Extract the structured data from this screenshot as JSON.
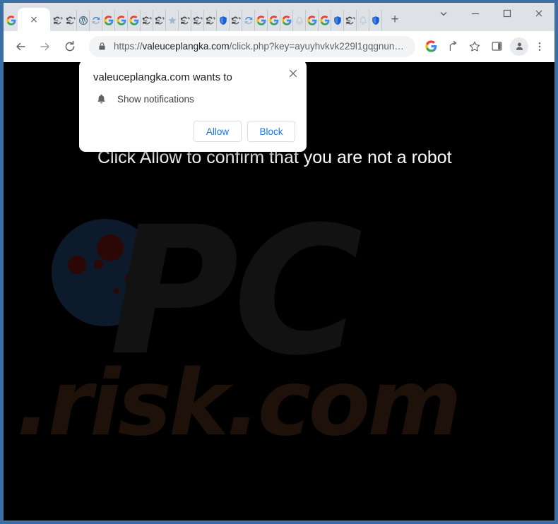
{
  "window": {
    "controls": [
      {
        "name": "tab-search-button",
        "glyph": "chevron-down"
      },
      {
        "name": "minimize-button",
        "glyph": "minimize"
      },
      {
        "name": "maximize-button",
        "glyph": "maximize"
      },
      {
        "name": "close-button",
        "glyph": "close"
      }
    ]
  },
  "tabstrip": {
    "active_tab": {
      "close_label": "×",
      "favicon": "google"
    },
    "leading_favicon": "google",
    "new_tab_label": "+",
    "tabs": [
      {
        "favicon": "ie"
      },
      {
        "favicon": "ie"
      },
      {
        "favicon": "wordpress"
      },
      {
        "favicon": "refresh"
      },
      {
        "favicon": "google"
      },
      {
        "favicon": "google"
      },
      {
        "favicon": "google"
      },
      {
        "favicon": "ie"
      },
      {
        "favicon": "ie"
      },
      {
        "favicon": "star"
      },
      {
        "favicon": "ie"
      },
      {
        "favicon": "ie"
      },
      {
        "favicon": "ie"
      },
      {
        "favicon": "shield"
      },
      {
        "favicon": "ie"
      },
      {
        "favicon": "refresh"
      },
      {
        "favicon": "google"
      },
      {
        "favicon": "google"
      },
      {
        "favicon": "google"
      },
      {
        "favicon": "bell"
      },
      {
        "favicon": "google"
      },
      {
        "favicon": "google"
      },
      {
        "favicon": "shield"
      },
      {
        "favicon": "ie"
      },
      {
        "favicon": "bell"
      },
      {
        "favicon": "shield"
      }
    ]
  },
  "toolbar": {
    "back_label": "Back",
    "forward_label": "Forward",
    "reload_label": "Reload",
    "omnibox": {
      "lock_icon": "lock-icon",
      "scheme": "https://",
      "host": "valeuceplangka.com",
      "path": "/click.php?key=ayuyhvkvk229l1gqgnun…",
      "full_url": "https://valeuceplangka.com/click.php?key=ayuyhvkvk229l1gqgnun…"
    },
    "actions": [
      {
        "name": "google-lens-icon",
        "label": "Search with Google"
      },
      {
        "name": "share-icon",
        "label": "Share this page"
      },
      {
        "name": "bookmark-star-icon",
        "label": "Bookmark this tab"
      },
      {
        "name": "side-panel-icon",
        "label": "Show side panel"
      }
    ],
    "avatar_label": "Profile",
    "menu_label": "Customize and control Google Chrome"
  },
  "page": {
    "background_color": "#000000",
    "headline": "Click Allow to confirm that you are not a robot",
    "watermark": {
      "line1": "PC",
      "line2": ".risk.com",
      "circle_color": "#0d1a2b",
      "text_color": "#121212",
      "accent_color": "#1d1109"
    }
  },
  "permission_dialog": {
    "title": "valeuceplangka.com wants to",
    "close_label": "×",
    "permission_icon": "bell-icon",
    "permission_label": "Show notifications",
    "allow_label": "Allow",
    "block_label": "Block",
    "accent_color": "#1a73e8"
  }
}
